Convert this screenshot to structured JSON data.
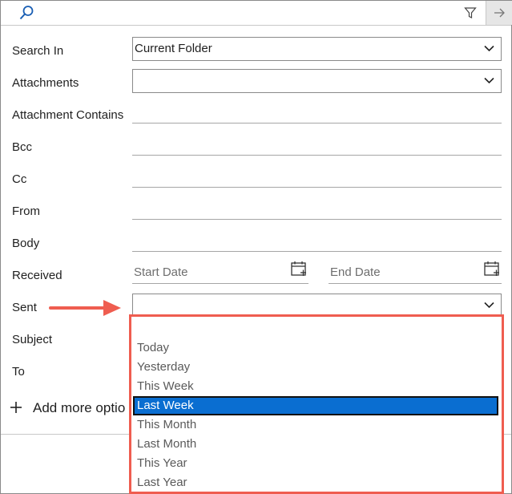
{
  "toolbar": {
    "search_icon": "search-icon",
    "filter_icon": "filter-icon",
    "go_icon": "arrow-right-icon"
  },
  "fields": {
    "search_in": {
      "label": "Search In",
      "value": "Current Folder"
    },
    "attachments": {
      "label": "Attachments",
      "value": ""
    },
    "attachment_contains": {
      "label": "Attachment Contains"
    },
    "bcc": {
      "label": "Bcc"
    },
    "cc": {
      "label": "Cc"
    },
    "from": {
      "label": "From"
    },
    "body": {
      "label": "Body"
    },
    "received": {
      "label": "Received",
      "start_placeholder": "Start Date",
      "end_placeholder": "End Date"
    },
    "sent": {
      "label": "Sent",
      "value": ""
    },
    "subject": {
      "label": "Subject"
    },
    "to": {
      "label": "To"
    }
  },
  "add_more": {
    "label": "Add more optio"
  },
  "sent_dropdown": {
    "options": [
      "",
      "Today",
      "Yesterday",
      "This Week",
      "Last Week",
      "This Month",
      "Last Month",
      "This Year",
      "Last Year"
    ],
    "selected": "Last Week"
  },
  "colors": {
    "highlight_border": "#ef5d50",
    "selection": "#0a6ed1",
    "arrow": "#ef5d50"
  }
}
